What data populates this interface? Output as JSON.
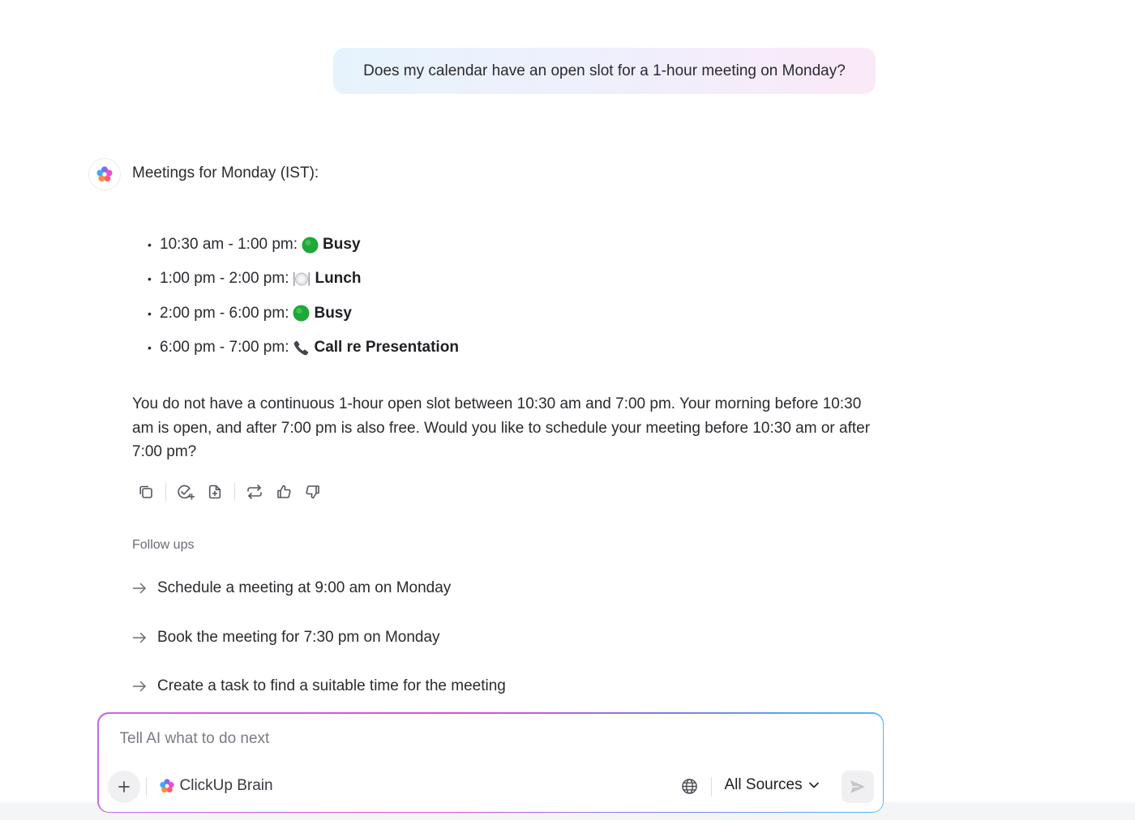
{
  "user_message": "Does my calendar have an open slot for a 1-hour meeting on Monday?",
  "ai_response": {
    "intro": "Meetings for Monday (IST):",
    "meetings": [
      {
        "time": "10:30 am - 1:00 pm:",
        "icon": "green-circle-icon",
        "status": "Busy"
      },
      {
        "time": "1:00 pm - 2:00 pm:",
        "icon": "plate-cutlery-icon",
        "status": "Lunch"
      },
      {
        "time": "2:00 pm - 6:00 pm:",
        "icon": "green-circle-icon",
        "status": "Busy"
      },
      {
        "time": "6:00 pm - 7:00 pm:",
        "icon": "phone-icon",
        "status": "Call re Presentation"
      }
    ],
    "paragraph": "You do not have a continuous 1-hour open slot between 10:30 am and 7:00 pm. Your morning before 10:30 am is open, and after 7:00 pm is also free. Would you like to schedule your meeting before 10:30 am or after 7:00 pm?",
    "actions": [
      "copy-icon",
      "check-add-icon",
      "add-doc-icon",
      "repeat-icon",
      "thumbs-up-icon",
      "thumbs-down-icon"
    ]
  },
  "followups": {
    "title": "Follow ups",
    "items": [
      "Schedule a meeting at 9:00 am on Monday",
      "Book the meeting for 7:30 pm on Monday",
      "Create a task to find a suitable time for the meeting"
    ]
  },
  "composer": {
    "placeholder": "Tell AI what to do next",
    "brain_label": "ClickUp Brain",
    "sources_label": "All Sources"
  },
  "colors": {
    "accent_pink": "#e24fc9",
    "accent_blue": "#53b9f0",
    "status_green": "#1fa83a"
  }
}
